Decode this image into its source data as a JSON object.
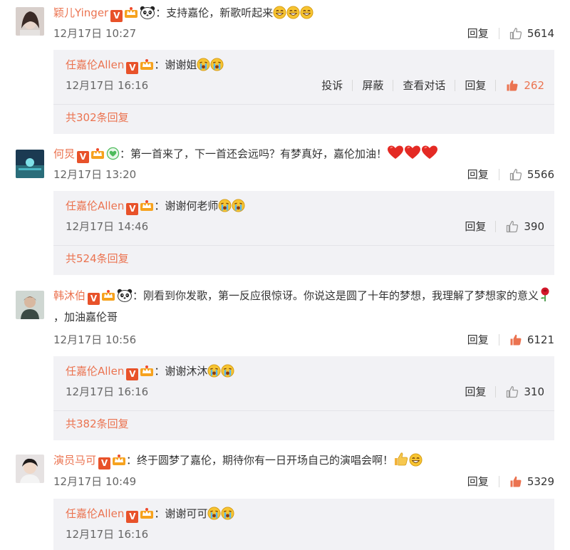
{
  "colors": {
    "accent": "#eb7350",
    "reply_bg": "#f2f2f5",
    "like_active": "#eb7350",
    "like_idle": "#999999"
  },
  "comments": [
    {
      "user": "颖儿Yinger",
      "text": "：支持嘉伦，新歌听起来",
      "time": "12月17日 10:27",
      "reply_label": "回复",
      "likes": "5614",
      "reply": {
        "user": "任嘉伦Allen",
        "text": "：谢谢姐",
        "time": "12月17日 16:16",
        "actions": [
          "投诉",
          "屏蔽",
          "查看对话",
          "回复"
        ],
        "likes": "262"
      },
      "more": "共302条回复"
    },
    {
      "user": "何炅",
      "text": "：第一首来了，下一首还会远吗？有梦真好，嘉伦加油！",
      "time": "12月17日 13:20",
      "reply_label": "回复",
      "likes": "5566",
      "reply": {
        "user": "任嘉伦Allen",
        "text": "：谢谢何老师",
        "time": "12月17日 14:46",
        "reply_label": "回复",
        "likes": "390"
      },
      "more": "共524条回复"
    },
    {
      "user": "韩沐伯",
      "text_part1": "：刚看到你发歌，第一反应很惊讶。你说这是圆了十年的梦想，我理解了梦想家的意义",
      "text_part2": "，加油嘉伦哥",
      "time": "12月17日 10:56",
      "reply_label": "回复",
      "likes": "6121",
      "reply": {
        "user": "任嘉伦Allen",
        "text": "：谢谢沐沐",
        "time": "12月17日 16:16",
        "reply_label": "回复",
        "likes": "310"
      },
      "more": "共382条回复"
    },
    {
      "user": "演员马可",
      "text": "：终于圆梦了嘉伦，期待你有一日开场自己的演唱会啊！",
      "time": "12月17日 10:49",
      "reply_label": "回复",
      "likes": "5329",
      "reply": {
        "user": "任嘉伦Allen",
        "text": "：谢谢可可",
        "time": "12月17日 16:16"
      }
    }
  ],
  "icons": {
    "verified": "V",
    "crown": "crown-badge-icon",
    "panda": "panda-emoji-icon",
    "smile": "smile-emoji-icon",
    "cry": "crying-emoji-icon",
    "heart": "heart-emoji-icon",
    "rose": "rose-emoji-icon",
    "thumb": "thumbs-up-emoji-icon",
    "like": "thumbs-up-icon"
  }
}
